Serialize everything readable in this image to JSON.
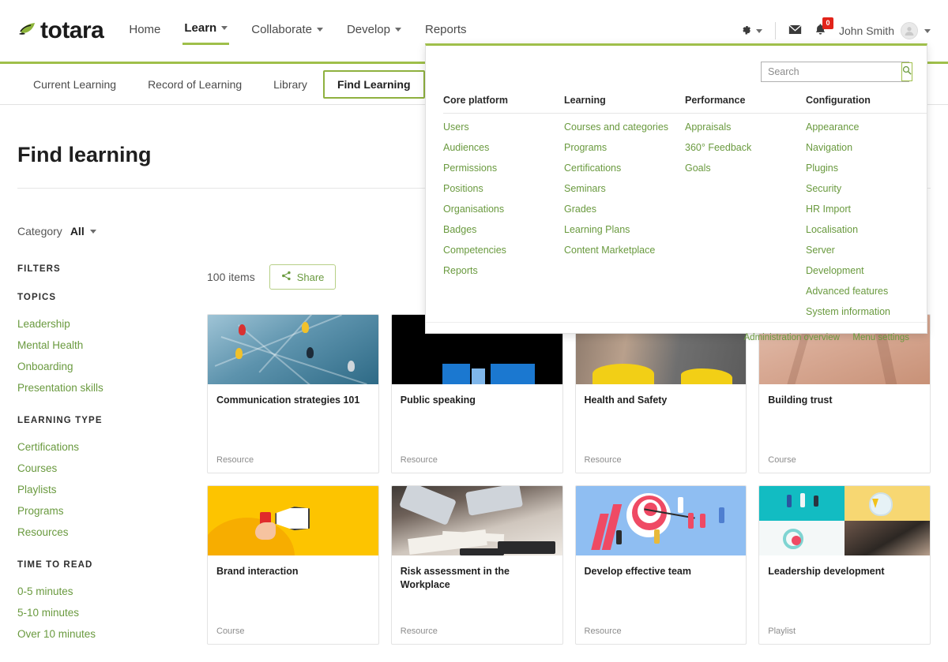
{
  "brand": {
    "name": "totara"
  },
  "primary_nav": [
    {
      "label": "Home",
      "has_caret": false,
      "active": false
    },
    {
      "label": "Learn",
      "has_caret": true,
      "active": true
    },
    {
      "label": "Collaborate",
      "has_caret": true,
      "active": false
    },
    {
      "label": "Develop",
      "has_caret": true,
      "active": false
    },
    {
      "label": "Reports",
      "has_caret": false,
      "active": false
    }
  ],
  "header_right": {
    "gear_icon": "gear-icon",
    "messages_icon": "envelope-icon",
    "notifications_icon": "bell-icon",
    "notification_count": "0",
    "user_name": "John Smith",
    "avatar_icon": "user-avatar-icon",
    "badge_color": "#e2231a"
  },
  "secondary_nav": [
    {
      "label": "Current Learning",
      "active": false
    },
    {
      "label": "Record of Learning",
      "active": false
    },
    {
      "label": "Library",
      "active": false
    },
    {
      "label": "Find Learning",
      "active": true
    }
  ],
  "page": {
    "title": "Find learning",
    "category_label": "Category",
    "category_value": "All"
  },
  "filters": {
    "title": "FILTERS",
    "groups": [
      {
        "title": "TOPICS",
        "items": [
          "Leadership",
          "Mental Health",
          "Onboarding",
          "Presentation skills"
        ]
      },
      {
        "title": "LEARNING TYPE",
        "items": [
          "Certifications",
          "Courses",
          "Playlists",
          "Programs",
          "Resources"
        ]
      },
      {
        "title": "TIME TO READ",
        "items": [
          "0-5 minutes",
          "5-10 minutes",
          "Over 10 minutes"
        ]
      }
    ]
  },
  "results": {
    "count_label": "100 items",
    "share_label": "Share",
    "share_icon": "share-icon"
  },
  "cards": [
    {
      "title": "Communication strategies 101",
      "type": "Resource",
      "art": "art-pins"
    },
    {
      "title": "Public speaking",
      "type": "Resource",
      "art": "art-dark"
    },
    {
      "title": "Health and Safety",
      "type": "Resource",
      "art": "art-yellow-gray"
    },
    {
      "title": "Building trust",
      "type": "Course",
      "art": "art-skin"
    },
    {
      "title": "Brand interaction",
      "type": "Course",
      "art": "art-megaphone"
    },
    {
      "title": "Risk assessment in the Workplace",
      "type": "Resource",
      "art": "art-desk"
    },
    {
      "title": "Develop effective team",
      "type": "Resource",
      "art": "art-target"
    },
    {
      "title": "Leadership development",
      "type": "Playlist",
      "art": "art-quad"
    }
  ],
  "admin_panel": {
    "search": {
      "placeholder": "Search",
      "value": "",
      "icon": "search-icon"
    },
    "columns": [
      {
        "heading": "Core platform",
        "items": [
          "Users",
          "Audiences",
          "Permissions",
          "Positions",
          "Organisations",
          "Badges",
          "Competencies",
          "Reports"
        ]
      },
      {
        "heading": "Learning",
        "items": [
          "Courses and categories",
          "Programs",
          "Certifications",
          "Seminars",
          "Grades",
          "Learning Plans",
          "Content Marketplace"
        ]
      },
      {
        "heading": "Performance",
        "items": [
          "Appraisals",
          "360° Feedback",
          "Goals"
        ]
      },
      {
        "heading": "Configuration",
        "items": [
          "Appearance",
          "Navigation",
          "Plugins",
          "Security",
          "HR Import",
          "Localisation",
          "Server",
          "Development",
          "Advanced features",
          "System information"
        ]
      }
    ],
    "footer_links": [
      "Administration overview",
      "Menu settings"
    ]
  },
  "colors": {
    "accent_green": "#9fbf4a",
    "link_green": "#6a9a3f",
    "badge_red": "#e2231a"
  }
}
